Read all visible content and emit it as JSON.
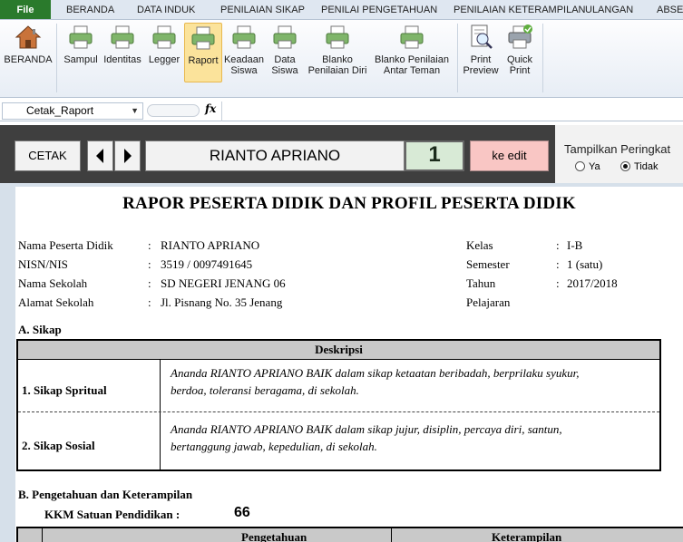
{
  "ribbon_tabs": {
    "file": "File",
    "items": [
      "BERANDA",
      "DATA INDUK",
      "PENILAIAN SIKAP",
      "PENILAI PENGETAHUAN",
      "PENILAIAN KETERAMPILAN",
      "ULANGAN",
      "ABSE"
    ]
  },
  "ribbon_buttons": {
    "beranda": "BERANDA",
    "sampul": "Sampul",
    "identitas": "Identitas",
    "legger": "Legger",
    "raport": "Raport",
    "keadaan_siswa_1": "Keadaan",
    "keadaan_siswa_2": "Siswa",
    "data_siswa_1": "Data",
    "data_siswa_2": "Siswa",
    "blanko_diri_1": "Blanko",
    "blanko_diri_2": "Penilaian Diri",
    "blanko_teman_1": "Blanko Penilaian",
    "blanko_teman_2": "Antar Teman",
    "print_preview_1": "Print",
    "print_preview_2": "Preview",
    "quick_print_1": "Quick",
    "quick_print_2": "Print"
  },
  "formula_bar": {
    "name_box": "Cetak_Raport",
    "fx": "fx"
  },
  "controls": {
    "cetak": "CETAK",
    "student_name": "RIANTO APRIANO",
    "number": "1",
    "edit": "ke edit",
    "peringkat_title": "Tampilkan Peringkat",
    "opt_ya": "Ya",
    "opt_tidak": "Tidak"
  },
  "report": {
    "title": "RAPOR PESERTA DIDIK DAN PROFIL PESERTA DIDIK",
    "left": [
      {
        "label": "Nama Peserta Didik",
        "sep": ":",
        "value": "RIANTO APRIANO"
      },
      {
        "label": "NISN/NIS",
        "sep": ":",
        "value": "3519 / 0097491645"
      },
      {
        "label": "Nama Sekolah",
        "sep": ":",
        "value": "SD NEGERI JENANG 06"
      },
      {
        "label": "Alamat Sekolah",
        "sep": ":",
        "value": "Jl. Pisnang No. 35 Jenang"
      }
    ],
    "right": [
      {
        "label": "Kelas",
        "sep": ":",
        "value": "I-B"
      },
      {
        "label": "Semester",
        "sep": ":",
        "value": "1 (satu)"
      },
      {
        "label": "Tahun",
        "sep": ":",
        "value": "2017/2018"
      },
      {
        "label": "Pelajaran",
        "sep": "",
        "value": ""
      }
    ],
    "section_a": "A.   Sikap",
    "sikap_header": "Deskripsi",
    "sikap_rows": [
      {
        "label": "1. Sikap Spritual",
        "line1": "Ananda RIANTO APRIANO  BAIK dalam sikap ketaatan beribadah, berprilaku syukur,",
        "line2": "berdoa, toleransi beragama,    di sekolah."
      },
      {
        "label": "2. Sikap Sosial",
        "line1": "Ananda RIANTO APRIANO  BAIK dalam sikap jujur, disiplin, percaya diri, santun,",
        "line2": "bertanggung jawab, kepedulian,    di sekolah."
      }
    ],
    "section_b": "B.   Pengetahuan dan Keterampilan",
    "kkm_label": "KKM Satuan Pendidikan :",
    "kkm_value": "66",
    "table2_headers": [
      "Pengetahuan",
      "Keterampilan"
    ]
  }
}
